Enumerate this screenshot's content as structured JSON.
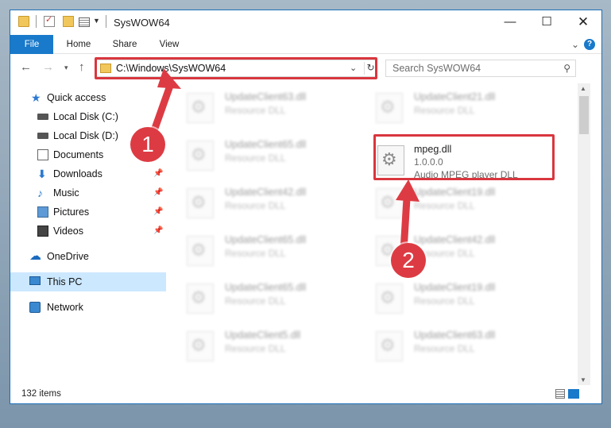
{
  "window": {
    "title": "SysWOW64",
    "min_glyph": "—",
    "max_glyph": "☐",
    "close_glyph": "✕"
  },
  "ribbon": {
    "tabs": [
      "File",
      "Home",
      "Share",
      "View"
    ],
    "expand_glyph": "⌄",
    "help_glyph": "?"
  },
  "nav": {
    "back_glyph": "←",
    "forward_glyph": "→",
    "recent_glyph": "▾",
    "up_glyph": "↑",
    "address_path": "C:\\Windows\\SysWOW64",
    "address_dropdown_glyph": "⌄",
    "refresh_glyph": "↻",
    "search_placeholder": "Search SysWOW64",
    "search_glyph": "⚲"
  },
  "sidebar": {
    "items": [
      {
        "label": "Quick access",
        "icon": "star-icon",
        "pinned": false
      },
      {
        "label": "Local Disk (C:)",
        "icon": "disk-icon",
        "pinned": false
      },
      {
        "label": "Local Disk (D:)",
        "icon": "disk-icon",
        "pinned": false
      },
      {
        "label": "Documents",
        "icon": "documents-icon",
        "pinned": false
      },
      {
        "label": "Downloads",
        "icon": "download-icon",
        "pinned": true
      },
      {
        "label": "Music",
        "icon": "music-icon",
        "pinned": true
      },
      {
        "label": "Pictures",
        "icon": "pictures-icon",
        "pinned": true
      },
      {
        "label": "Videos",
        "icon": "videos-icon",
        "pinned": true
      },
      {
        "label": "OneDrive",
        "icon": "cloud-icon",
        "pinned": false
      },
      {
        "label": "This PC",
        "icon": "computer-icon",
        "pinned": false,
        "selected": true
      },
      {
        "label": "Network",
        "icon": "network-icon",
        "pinned": false
      }
    ],
    "pin_glyph": "📌"
  },
  "files": {
    "left_column": [
      {
        "name": "UpdateClient63.dll",
        "type": "Resource DLL"
      },
      {
        "name": "UpdateClient65.dll",
        "type": "Resource DLL"
      },
      {
        "name": "UpdateClient42.dll",
        "type": "Resource DLL"
      },
      {
        "name": "UpdateClient65.dll",
        "type": "Resource DLL"
      },
      {
        "name": "UpdateClient65.dll",
        "type": "Resource DLL"
      },
      {
        "name": "UpdateClient5.dll",
        "type": "Resource DLL"
      }
    ],
    "right_column": [
      {
        "name": "UpdateClient21.dll",
        "type": "Resource DLL"
      },
      {
        "name": "UpdateClient19.dll",
        "type": "Resource DLL"
      },
      {
        "name": "UpdateClient42.dll",
        "type": "Resource DLL"
      },
      {
        "name": "UpdateClient19.dll",
        "type": "Resource DLL"
      },
      {
        "name": "UpdateClient63.dll",
        "type": "Resource DLL"
      }
    ],
    "featured": {
      "name": "mpeg.dll",
      "version": "1.0.0.0",
      "description": "Audio MPEG player DLL"
    }
  },
  "status": {
    "item_count": "132 items"
  },
  "annotations": {
    "marker1": "1",
    "marker2": "2",
    "color": "#dd3b43"
  }
}
